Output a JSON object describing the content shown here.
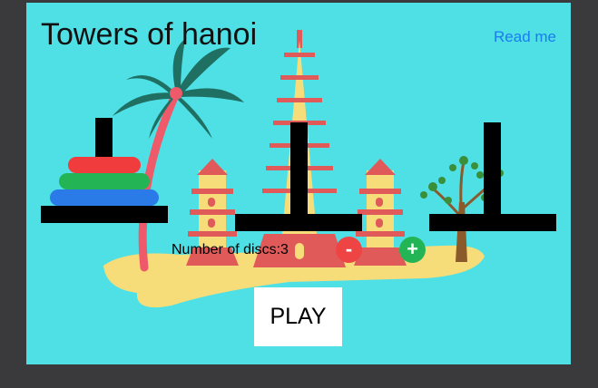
{
  "header": {
    "title": "Towers of hanoi",
    "readme_label": "Read me"
  },
  "controls": {
    "discs_label": "Number of discs:3",
    "minus_label": "-",
    "plus_label": "+",
    "play_label": "PLAY"
  },
  "game": {
    "disc_count": 3,
    "towers": [
      {
        "name": "left",
        "discs": [
          "red",
          "green",
          "blue"
        ]
      },
      {
        "name": "middle",
        "discs": []
      },
      {
        "name": "right",
        "discs": []
      }
    ]
  },
  "colors": {
    "background": "#4fe0e5",
    "frame": "#3a3a3c",
    "disc_red": "#f03c3c",
    "disc_green": "#22b455",
    "disc_blue": "#2a7ae8",
    "pole": "#000000",
    "minus_button": "#ee4444",
    "plus_button": "#22b455"
  },
  "icons": [
    "palm-tree-icon",
    "pagoda-icon",
    "tree-icon",
    "island-icon"
  ]
}
